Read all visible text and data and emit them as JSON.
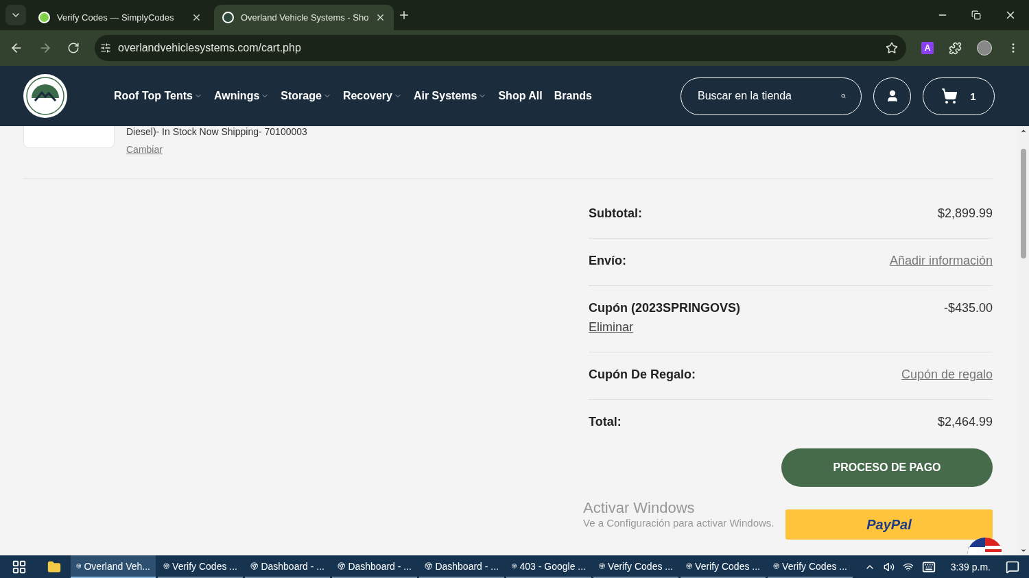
{
  "browser": {
    "tabs": [
      {
        "title": "Verify Codes — SimplyCodes",
        "selected": false
      },
      {
        "title": "Overland Vehicle Systems - Sho",
        "selected": true
      }
    ],
    "url": "overlandvehiclesystems.com/cart.php",
    "extension_badge": "A"
  },
  "site_header": {
    "nav": [
      {
        "label": "Roof Top Tents",
        "dropdown": true
      },
      {
        "label": "Awnings",
        "dropdown": true
      },
      {
        "label": "Storage",
        "dropdown": true
      },
      {
        "label": "Recovery",
        "dropdown": true
      },
      {
        "label": "Air Systems",
        "dropdown": true
      },
      {
        "label": "Shop All",
        "dropdown": false
      },
      {
        "label": "Brands",
        "dropdown": false
      }
    ],
    "search": {
      "placeholder": "Buscar en la tienda"
    },
    "cart_count": "1"
  },
  "cart_item": {
    "details": "Diesel)- In Stock Now Shipping- 70100003",
    "change_link": "Cambiar"
  },
  "summary": [
    {
      "kind": "value",
      "label": "Subtotal:",
      "value": "$2,899.99"
    },
    {
      "kind": "link",
      "label": "Envío:",
      "value": "Añadir información"
    },
    {
      "kind": "coupon",
      "label": "Cupón (2023SPRINGOVS)",
      "value": "-$435.00",
      "action": "Eliminar"
    },
    {
      "kind": "link",
      "label": "Cupón De Regalo:",
      "value": "Cupón de regalo"
    },
    {
      "kind": "total",
      "label": "Total:",
      "value": "$2,464.99"
    }
  ],
  "checkout_button": "PROCESO DE PAGO",
  "paypal_button": "PayPal",
  "windows_notice": {
    "title": "Activar Windows",
    "message": "Ve a Configuración para activar Windows."
  },
  "taskbar": {
    "items": [
      {
        "label": "Overland Veh...",
        "selected": true
      },
      {
        "label": "Verify Codes ...",
        "selected": false
      },
      {
        "label": "Dashboard - ...",
        "selected": false
      },
      {
        "label": "Dashboard - ...",
        "selected": false
      },
      {
        "label": "Dashboard - ...",
        "selected": false
      },
      {
        "label": "403 - Google ...",
        "selected": false
      },
      {
        "label": "Verify Codes ...",
        "selected": false
      },
      {
        "label": "Verify Codes ...",
        "selected": false
      },
      {
        "label": "Verify Codes ...",
        "selected": false
      }
    ],
    "time": "3:39 p.m."
  }
}
